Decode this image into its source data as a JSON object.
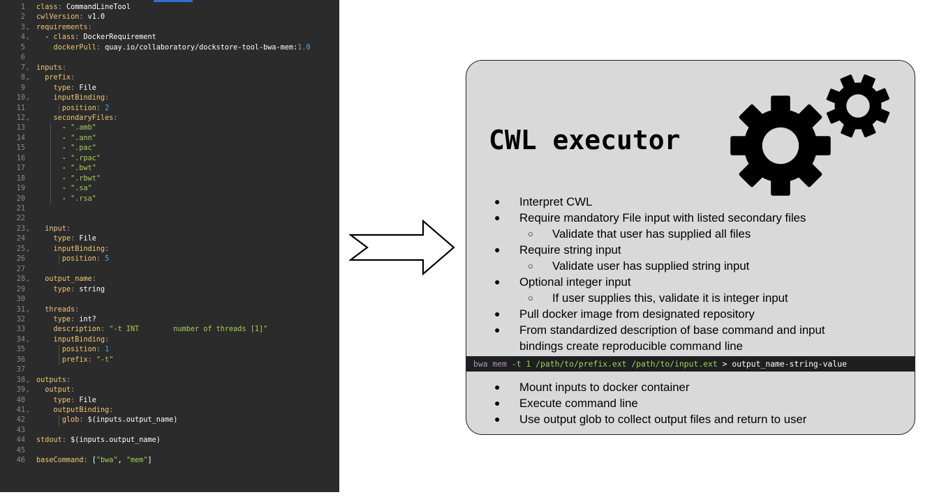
{
  "editor": {
    "lines": [
      {
        "n": "1",
        "fold": false,
        "indent": 0,
        "parts": [
          [
            "k",
            "class"
          ],
          [
            "p",
            ": "
          ],
          [
            "v",
            "CommandLineTool"
          ]
        ]
      },
      {
        "n": "2",
        "fold": false,
        "indent": 0,
        "parts": [
          [
            "k",
            "cwlVersion"
          ],
          [
            "p",
            ": "
          ],
          [
            "v",
            "v1.0"
          ]
        ]
      },
      {
        "n": "3",
        "fold": true,
        "indent": 0,
        "parts": [
          [
            "k",
            "requirements"
          ],
          [
            "p",
            ":"
          ]
        ]
      },
      {
        "n": "4",
        "fold": true,
        "indent": 0,
        "parts": [
          [
            "v",
            "  - "
          ],
          [
            "k",
            "class"
          ],
          [
            "p",
            ": "
          ],
          [
            "v",
            "DockerRequirement"
          ]
        ]
      },
      {
        "n": "5",
        "fold": false,
        "indent": 0,
        "parts": [
          [
            "v",
            "    "
          ],
          [
            "k",
            "dockerPull"
          ],
          [
            "p",
            ": "
          ],
          [
            "v",
            "quay.io/collaboratory/dockstore-tool-bwa-mem:"
          ],
          [
            "n",
            "1.0"
          ]
        ]
      },
      {
        "n": "6",
        "fold": false,
        "indent": 0,
        "parts": []
      },
      {
        "n": "7",
        "fold": true,
        "indent": 0,
        "parts": [
          [
            "k",
            "inputs"
          ],
          [
            "p",
            ":"
          ]
        ]
      },
      {
        "n": "8",
        "fold": true,
        "indent": 0,
        "parts": [
          [
            "v",
            "  "
          ],
          [
            "k",
            "prefix"
          ],
          [
            "p",
            ":"
          ]
        ]
      },
      {
        "n": "9",
        "fold": false,
        "indent": 0,
        "parts": [
          [
            "v",
            "    "
          ],
          [
            "k",
            "type"
          ],
          [
            "p",
            ": "
          ],
          [
            "v",
            "File"
          ]
        ]
      },
      {
        "n": "10",
        "fold": true,
        "indent": 0,
        "parts": [
          [
            "v",
            "    "
          ],
          [
            "k",
            "inputBinding"
          ],
          [
            "p",
            ":"
          ]
        ]
      },
      {
        "n": "11",
        "fold": false,
        "indent": 0,
        "parts": [
          [
            "v",
            "      "
          ],
          [
            "k",
            "position"
          ],
          [
            "p",
            ": "
          ],
          [
            "n",
            "2"
          ]
        ]
      },
      {
        "n": "12",
        "fold": true,
        "indent": 0,
        "parts": [
          [
            "v",
            "    "
          ],
          [
            "k",
            "secondaryFiles"
          ],
          [
            "p",
            ":"
          ]
        ]
      },
      {
        "n": "13",
        "fold": false,
        "indent": 0,
        "parts": [
          [
            "v",
            "      - "
          ],
          [
            "s",
            "\".amb\""
          ]
        ]
      },
      {
        "n": "14",
        "fold": false,
        "indent": 0,
        "parts": [
          [
            "v",
            "      - "
          ],
          [
            "s",
            "\".ann\""
          ]
        ]
      },
      {
        "n": "15",
        "fold": false,
        "indent": 0,
        "parts": [
          [
            "v",
            "      - "
          ],
          [
            "s",
            "\".pac\""
          ]
        ]
      },
      {
        "n": "16",
        "fold": false,
        "indent": 0,
        "parts": [
          [
            "v",
            "      - "
          ],
          [
            "s",
            "\".rpac\""
          ]
        ]
      },
      {
        "n": "17",
        "fold": false,
        "indent": 0,
        "parts": [
          [
            "v",
            "      - "
          ],
          [
            "s",
            "\".bwt\""
          ]
        ]
      },
      {
        "n": "18",
        "fold": false,
        "indent": 0,
        "parts": [
          [
            "v",
            "      - "
          ],
          [
            "s",
            "\".rbwt\""
          ]
        ]
      },
      {
        "n": "19",
        "fold": false,
        "indent": 0,
        "parts": [
          [
            "v",
            "      - "
          ],
          [
            "s",
            "\".sa\""
          ]
        ]
      },
      {
        "n": "20",
        "fold": false,
        "indent": 0,
        "parts": [
          [
            "v",
            "      - "
          ],
          [
            "s",
            "\".rsa\""
          ]
        ]
      },
      {
        "n": "21",
        "fold": false,
        "indent": 0,
        "parts": []
      },
      {
        "n": "22",
        "fold": false,
        "indent": 0,
        "parts": []
      },
      {
        "n": "23",
        "fold": true,
        "indent": 0,
        "parts": [
          [
            "v",
            "  "
          ],
          [
            "k",
            "input"
          ],
          [
            "p",
            ":"
          ]
        ]
      },
      {
        "n": "24",
        "fold": false,
        "indent": 0,
        "parts": [
          [
            "v",
            "    "
          ],
          [
            "k",
            "type"
          ],
          [
            "p",
            ": "
          ],
          [
            "v",
            "File"
          ]
        ]
      },
      {
        "n": "25",
        "fold": true,
        "indent": 0,
        "parts": [
          [
            "v",
            "    "
          ],
          [
            "k",
            "inputBinding"
          ],
          [
            "p",
            ":"
          ]
        ]
      },
      {
        "n": "26",
        "fold": false,
        "indent": 0,
        "parts": [
          [
            "v",
            "      "
          ],
          [
            "k",
            "position"
          ],
          [
            "p",
            ": "
          ],
          [
            "n",
            "5"
          ]
        ]
      },
      {
        "n": "27",
        "fold": false,
        "indent": 0,
        "parts": []
      },
      {
        "n": "28",
        "fold": true,
        "indent": 0,
        "parts": [
          [
            "v",
            "  "
          ],
          [
            "k",
            "output_name"
          ],
          [
            "p",
            ":"
          ]
        ]
      },
      {
        "n": "29",
        "fold": false,
        "indent": 0,
        "parts": [
          [
            "v",
            "    "
          ],
          [
            "k",
            "type"
          ],
          [
            "p",
            ": "
          ],
          [
            "v",
            "string"
          ]
        ]
      },
      {
        "n": "30",
        "fold": false,
        "indent": 0,
        "parts": []
      },
      {
        "n": "31",
        "fold": true,
        "indent": 0,
        "parts": [
          [
            "v",
            "  "
          ],
          [
            "k",
            "threads"
          ],
          [
            "p",
            ":"
          ]
        ]
      },
      {
        "n": "32",
        "fold": false,
        "indent": 0,
        "parts": [
          [
            "v",
            "    "
          ],
          [
            "k",
            "type"
          ],
          [
            "p",
            ": "
          ],
          [
            "v",
            "int?"
          ]
        ]
      },
      {
        "n": "33",
        "fold": false,
        "indent": 0,
        "parts": [
          [
            "v",
            "    "
          ],
          [
            "k",
            "description"
          ],
          [
            "p",
            ": "
          ],
          [
            "s",
            "\"-t INT        number of threads [1]\""
          ]
        ]
      },
      {
        "n": "34",
        "fold": true,
        "indent": 0,
        "parts": [
          [
            "v",
            "    "
          ],
          [
            "k",
            "inputBinding"
          ],
          [
            "p",
            ":"
          ]
        ]
      },
      {
        "n": "35",
        "fold": false,
        "indent": 0,
        "parts": [
          [
            "v",
            "      "
          ],
          [
            "k",
            "position"
          ],
          [
            "p",
            ": "
          ],
          [
            "n",
            "1"
          ]
        ]
      },
      {
        "n": "36",
        "fold": false,
        "indent": 0,
        "parts": [
          [
            "v",
            "      "
          ],
          [
            "k",
            "prefix"
          ],
          [
            "p",
            ": "
          ],
          [
            "s",
            "\"-t\""
          ]
        ]
      },
      {
        "n": "37",
        "fold": false,
        "indent": 0,
        "parts": []
      },
      {
        "n": "38",
        "fold": true,
        "indent": 0,
        "parts": [
          [
            "k",
            "outputs"
          ],
          [
            "p",
            ":"
          ]
        ]
      },
      {
        "n": "39",
        "fold": true,
        "indent": 0,
        "parts": [
          [
            "v",
            "  "
          ],
          [
            "k",
            "output"
          ],
          [
            "p",
            ":"
          ]
        ]
      },
      {
        "n": "40",
        "fold": false,
        "indent": 0,
        "parts": [
          [
            "v",
            "    "
          ],
          [
            "k",
            "type"
          ],
          [
            "p",
            ": "
          ],
          [
            "v",
            "File"
          ]
        ]
      },
      {
        "n": "41",
        "fold": true,
        "indent": 0,
        "parts": [
          [
            "v",
            "    "
          ],
          [
            "k",
            "outputBinding"
          ],
          [
            "p",
            ":"
          ]
        ]
      },
      {
        "n": "42",
        "fold": false,
        "indent": 0,
        "parts": [
          [
            "v",
            "      "
          ],
          [
            "k",
            "glob"
          ],
          [
            "p",
            ": "
          ],
          [
            "v",
            "$(inputs.output_name)"
          ]
        ]
      },
      {
        "n": "43",
        "fold": false,
        "indent": 0,
        "parts": []
      },
      {
        "n": "44",
        "fold": false,
        "indent": 0,
        "parts": [
          [
            "k",
            "stdout"
          ],
          [
            "p",
            ": "
          ],
          [
            "v",
            "$(inputs.output_name)"
          ]
        ]
      },
      {
        "n": "45",
        "fold": false,
        "indent": 0,
        "parts": []
      },
      {
        "n": "46",
        "fold": false,
        "indent": 0,
        "parts": [
          [
            "k",
            "baseCommand"
          ],
          [
            "p",
            ": "
          ],
          [
            "v",
            "["
          ],
          [
            "s",
            "\"bwa\""
          ],
          [
            "v",
            ", "
          ],
          [
            "s",
            "\"mem\""
          ],
          [
            "v",
            "]"
          ]
        ]
      }
    ]
  },
  "executor": {
    "title": "CWL executor",
    "bullets_top": [
      {
        "level": 1,
        "text": "Interpret CWL"
      },
      {
        "level": 1,
        "text": "Require mandatory File input with listed secondary files"
      },
      {
        "level": 2,
        "text": "Validate that user has supplied all files"
      },
      {
        "level": 1,
        "text": "Require string input"
      },
      {
        "level": 2,
        "text": "Validate user has supplied string input"
      },
      {
        "level": 1,
        "text": "Optional integer input"
      },
      {
        "level": 2,
        "text": "If user supplies this, validate it is integer input"
      },
      {
        "level": 1,
        "text": "Pull docker image from designated repository"
      },
      {
        "level": 1,
        "text": "From standardized description of base command and input bindings create reproducible command line",
        "tall": true
      }
    ],
    "command_line": {
      "cmd": "bwa mem",
      "args": " -t 1 /path/to/prefix.ext /path/to/input.ext",
      "redirect": " > output_name-string-value"
    },
    "bullets_bottom": [
      {
        "level": 1,
        "text": "Mount inputs to docker container"
      },
      {
        "level": 1,
        "text": "Execute command line"
      },
      {
        "level": 1,
        "text": "Use output glob to collect output files and return to user"
      }
    ],
    "bullet_marks": {
      "level1": "●",
      "level2": "○"
    }
  }
}
